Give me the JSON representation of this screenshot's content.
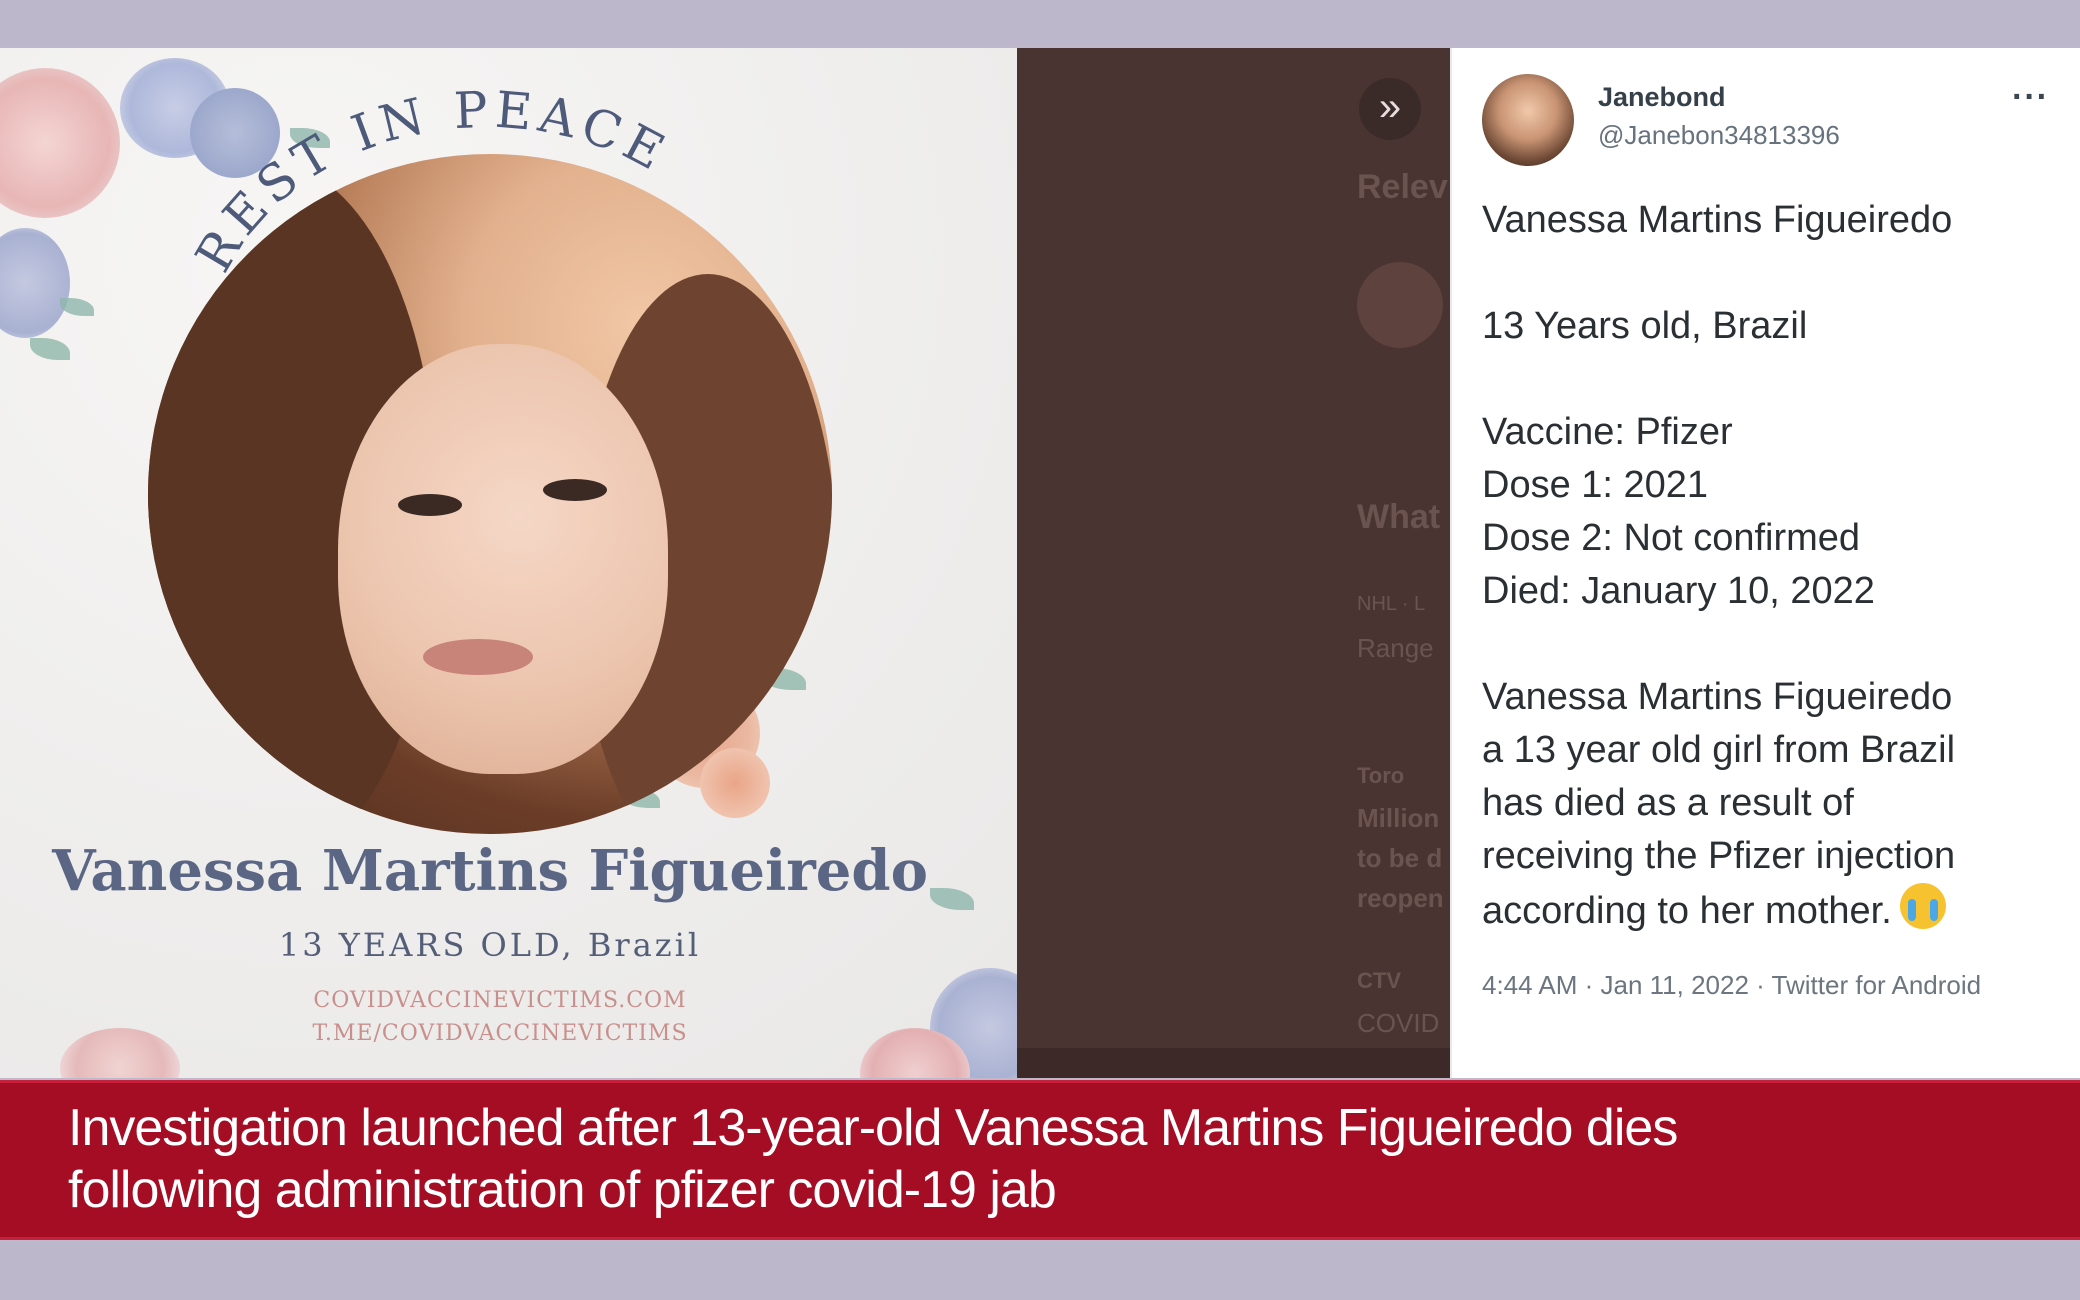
{
  "memorial": {
    "heading": "REST IN PEACE",
    "name": "Vanessa Martins Figueiredo",
    "age_line": "13 YEARS OLD, Brazil",
    "link_primary": "COVIDVACCINEVICTIMS.COM",
    "link_secondary": "T.ME/COVIDVACCINEVICTIMS"
  },
  "background_page": {
    "expand_icon": "chevrons-right-icon",
    "fragments": [
      "Relev",
      "What",
      "NHL · L",
      "Range",
      "Toro",
      "Million",
      "to be d",
      "reopen",
      "CTV",
      "COVID"
    ]
  },
  "tweet": {
    "display_name": "Janebond",
    "handle": "@Janebon34813396",
    "more_icon": "more-options-icon",
    "paragraphs": [
      "Vanessa Martins Figueiredo",
      "",
      "13 Years old, Brazil",
      "",
      "Vaccine: Pfizer",
      "Dose 1: 2021",
      "Dose 2: Not confirmed",
      "Died: January 10, 2022",
      "",
      "Vanessa Martins Figueiredo",
      "a 13 year old girl from Brazil",
      "has died as a result of",
      "receiving the Pfizer injection",
      "according to her mother."
    ],
    "emoji_icon": "loudly-crying-face-icon",
    "meta": "4:44 AM · Jan 11, 2022 · Twitter for Android"
  },
  "banner": {
    "headline_line1": "Investigation launched after 13-year-old Vanessa Martins Figueiredo dies",
    "headline_line2": "following administration of pfizer covid-19 jab"
  },
  "colors": {
    "banner": "#a40d24",
    "memorial_text": "#5a6684",
    "link_text": "#c98f8c",
    "dim_overlay": "#4a3431"
  }
}
